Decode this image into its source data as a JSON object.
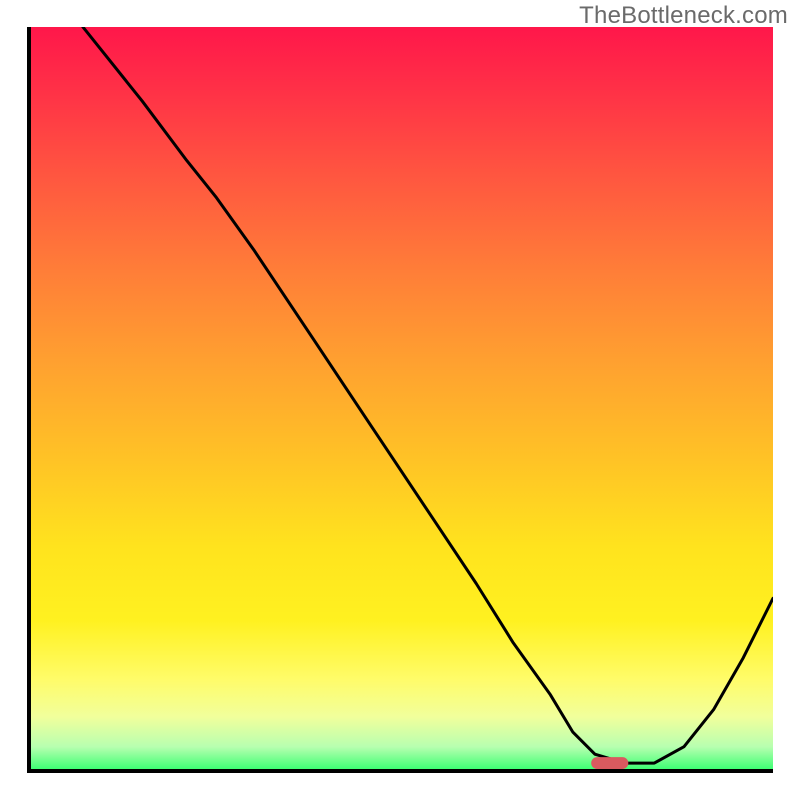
{
  "watermark": "TheBottleneck.com",
  "chart_data": {
    "type": "line",
    "title": "",
    "xlabel": "",
    "ylabel": "",
    "xlim": [
      0,
      100
    ],
    "ylim": [
      0,
      100
    ],
    "grid": false,
    "series": [
      {
        "name": "curve",
        "x": [
          7,
          15,
          21,
          25,
          30,
          38,
          46,
          54,
          60,
          65,
          70,
          73,
          76,
          80,
          84,
          88,
          92,
          96,
          100
        ],
        "y": [
          100,
          90,
          82,
          77,
          70,
          58,
          46,
          34,
          25,
          17,
          10,
          5,
          2,
          0.8,
          0.8,
          3,
          8,
          15,
          23
        ]
      }
    ],
    "marker": {
      "x": 78,
      "y": 0.8,
      "w": 5,
      "h": 1.6,
      "color": "#d95a5f"
    },
    "background_gradient": {
      "top_color": "#ff174a",
      "bottom_color": "#3fff74",
      "description": "vertical red→orange→yellow→green gradient"
    }
  }
}
